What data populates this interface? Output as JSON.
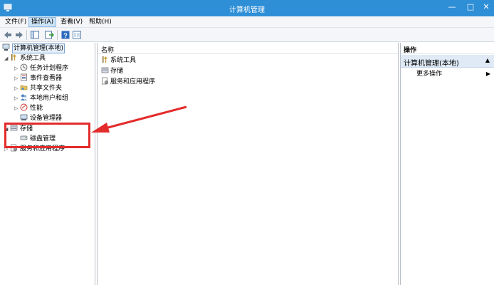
{
  "window": {
    "title": "计算机管理"
  },
  "menu": {
    "items": [
      {
        "label": "文件(F)"
      },
      {
        "label": "操作(A)"
      },
      {
        "label": "查看(V)"
      },
      {
        "label": "帮助(H)"
      }
    ]
  },
  "toolbar": {
    "buttons": [
      "back-arrow-icon",
      "forward-arrow-icon",
      "show-tree-icon",
      "export-list-icon",
      "help-icon",
      "properties-icon"
    ]
  },
  "tree": {
    "root": "计算机管理(本地)",
    "system_tools": "系统工具",
    "task_scheduler": "任务计划程序",
    "event_viewer": "事件查看器",
    "shared_folders": "共享文件夹",
    "local_users": "本地用户和组",
    "performance": "性能",
    "device_manager": "设备管理器",
    "storage": "存储",
    "disk_management": "磁盘管理",
    "services_apps": "服务和应用程序"
  },
  "list": {
    "column_name": "名称",
    "rows": [
      "系统工具",
      "存储",
      "服务和应用程序"
    ]
  },
  "actions": {
    "header": "操作",
    "section": "计算机管理(本地)",
    "more": "更多操作"
  },
  "colors": {
    "titlebar": "#2f8fd6",
    "annotation": "#e32b2b",
    "selection": "#cde4f7"
  }
}
